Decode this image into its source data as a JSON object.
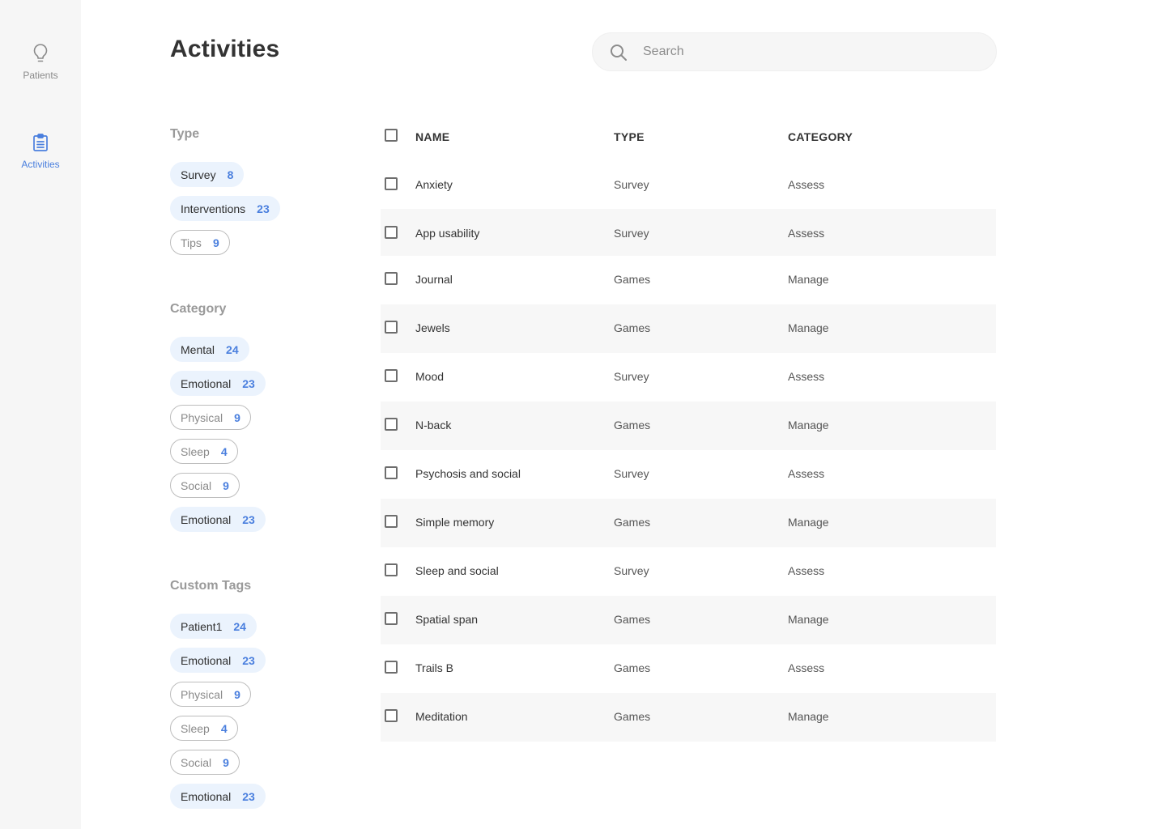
{
  "nav": {
    "items": [
      {
        "label": "Patients",
        "icon": "lightbulb-icon",
        "active": false
      },
      {
        "label": "Activities",
        "icon": "clipboard-icon",
        "active": true
      }
    ]
  },
  "page": {
    "title": "Activities"
  },
  "search": {
    "placeholder": "Search",
    "value": ""
  },
  "filters": {
    "type": {
      "heading": "Type",
      "chips": [
        {
          "label": "Survey",
          "count": "8",
          "selected": true
        },
        {
          "label": "Interventions",
          "count": "23",
          "selected": true
        },
        {
          "label": "Tips",
          "count": "9",
          "selected": false
        }
      ]
    },
    "category": {
      "heading": "Category",
      "chips": [
        {
          "label": "Mental",
          "count": "24",
          "selected": true
        },
        {
          "label": "Emotional",
          "count": "23",
          "selected": true
        },
        {
          "label": "Physical",
          "count": "9",
          "selected": false
        },
        {
          "label": "Sleep",
          "count": "4",
          "selected": false
        },
        {
          "label": "Social",
          "count": "9",
          "selected": false
        },
        {
          "label": "Emotional",
          "count": "23",
          "selected": true
        }
      ]
    },
    "custom_tags": {
      "heading": "Custom Tags",
      "chips": [
        {
          "label": "Patient1",
          "count": "24",
          "selected": true
        },
        {
          "label": "Emotional",
          "count": "23",
          "selected": true
        },
        {
          "label": "Physical",
          "count": "9",
          "selected": false
        },
        {
          "label": "Sleep",
          "count": "4",
          "selected": false
        },
        {
          "label": "Social",
          "count": "9",
          "selected": false
        },
        {
          "label": "Emotional",
          "count": "23",
          "selected": true
        }
      ]
    }
  },
  "table": {
    "columns": [
      "NAME",
      "TYPE",
      "CATEGORY"
    ],
    "rows": [
      {
        "name": "Anxiety",
        "type": "Survey",
        "category": "Assess"
      },
      {
        "name": "App usability",
        "type": "Survey",
        "category": "Assess"
      },
      {
        "name": "Journal",
        "type": "Games",
        "category": "Manage"
      },
      {
        "name": "Jewels",
        "type": "Games",
        "category": "Manage"
      },
      {
        "name": "Mood",
        "type": "Survey",
        "category": "Assess"
      },
      {
        "name": "N-back",
        "type": "Games",
        "category": "Manage"
      },
      {
        "name": "Psychosis and social",
        "type": "Survey",
        "category": "Assess"
      },
      {
        "name": "Simple memory",
        "type": "Games",
        "category": "Manage"
      },
      {
        "name": "Sleep and social",
        "type": "Survey",
        "category": "Assess"
      },
      {
        "name": "Spatial span",
        "type": "Games",
        "category": "Manage"
      },
      {
        "name": "Trails B",
        "type": "Games",
        "category": "Assess"
      },
      {
        "name": "Meditation",
        "type": "Games",
        "category": "Manage"
      }
    ]
  },
  "colors": {
    "accent": "#4a7fde",
    "chip_selected_bg": "#ebf3fd",
    "sidebar_bg": "#f6f6f6",
    "row_alt_bg": "#f7f7f7"
  }
}
